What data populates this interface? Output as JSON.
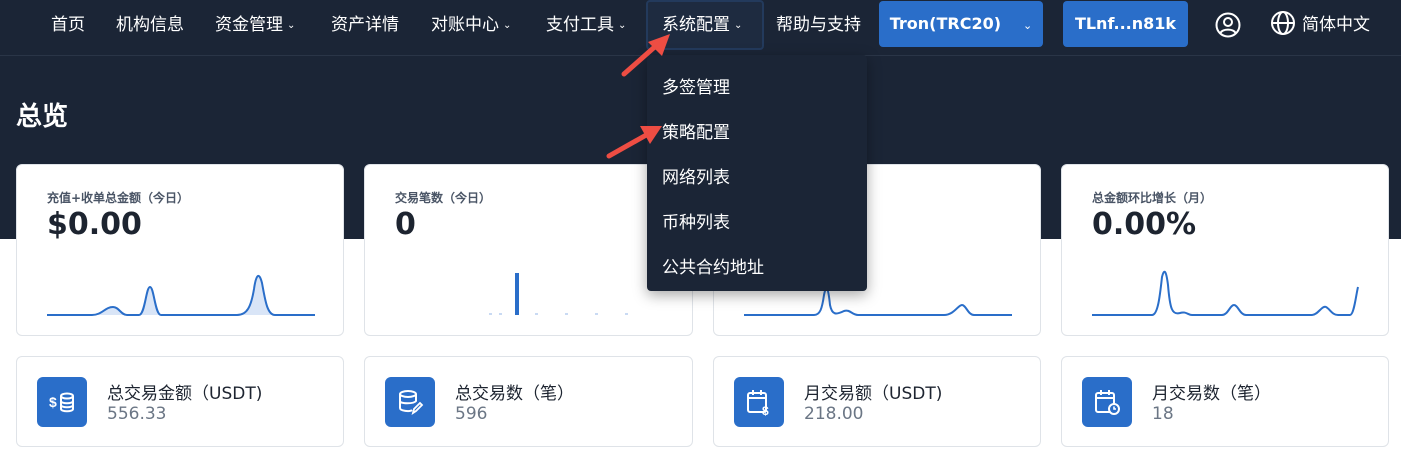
{
  "nav": {
    "items": [
      {
        "label": "首页",
        "chevron": false
      },
      {
        "label": "机构信息",
        "chevron": false
      },
      {
        "label": "资金管理",
        "chevron": true
      },
      {
        "label": "资产详情",
        "chevron": false
      },
      {
        "label": "对账中心",
        "chevron": true
      },
      {
        "label": "支付工具",
        "chevron": true
      },
      {
        "label": "系统配置",
        "chevron": true,
        "active": true
      },
      {
        "label": "帮助与支持",
        "chevron": false
      }
    ],
    "network_button": "Tron(TRC20)",
    "wallet_button": "TLnf...n81k",
    "language": "简体中文",
    "chevron_glyph": "⌄"
  },
  "dropdown": {
    "items": [
      "多签管理",
      "策略配置",
      "网络列表",
      "币种列表",
      "公共合约地址"
    ]
  },
  "page": {
    "title": "总览"
  },
  "overview_cards": [
    {
      "label": "充值+收单总金额（今日）",
      "value": "$0.00"
    },
    {
      "label": "交易笔数（今日）",
      "value": "0"
    },
    {
      "label": "",
      "value": ""
    },
    {
      "label": "总金额环比增长（月）",
      "value": "0.00%"
    }
  ],
  "stats": [
    {
      "label": "总交易金额（USDT)",
      "value": "556.33",
      "icon": "dollar-coins-icon"
    },
    {
      "label": "总交易数（笔）",
      "value": "596",
      "icon": "database-edit-icon"
    },
    {
      "label": "月交易额（USDT)",
      "value": "218.00",
      "icon": "calendar-dollar-icon"
    },
    {
      "label": "月交易数（笔）",
      "value": "18",
      "icon": "calendar-clock-icon"
    }
  ],
  "colors": {
    "navy": "#1b2536",
    "accent_blue": "#2a6ec9",
    "arrow_red": "#ee4d43",
    "spark_line": "#2a6ec9"
  }
}
